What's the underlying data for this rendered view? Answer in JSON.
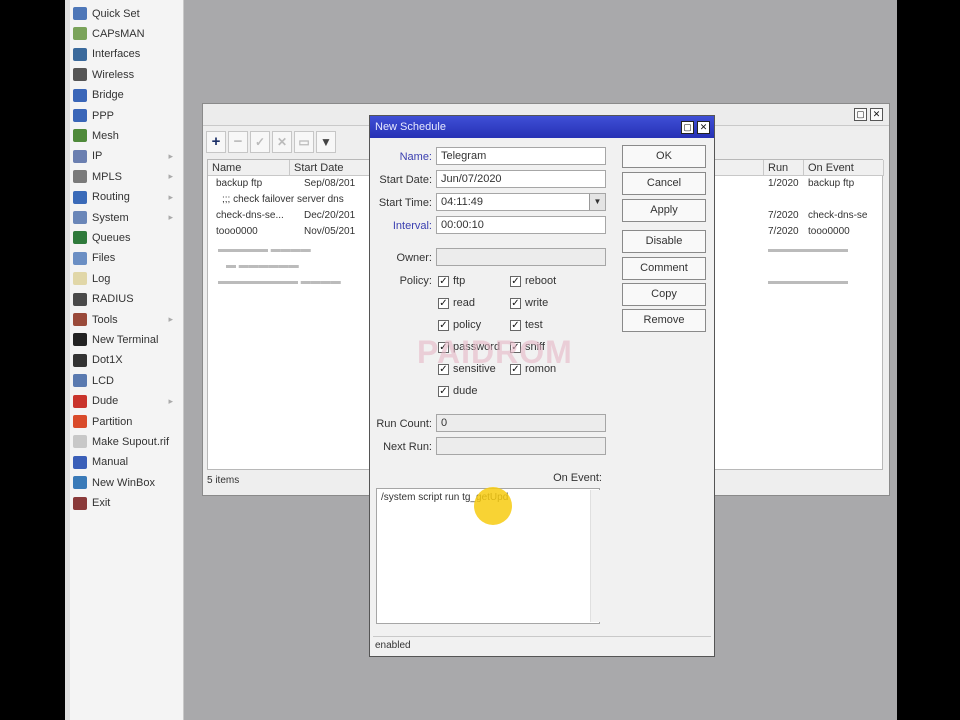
{
  "menu": {
    "items": [
      {
        "label": "Quick Set",
        "icon": "quick-set-icon",
        "color": "#4e77b8"
      },
      {
        "label": "CAPsMAN",
        "icon": "capsman-icon",
        "color": "#7aa35a"
      },
      {
        "label": "Interfaces",
        "icon": "interfaces-icon",
        "color": "#3b6a9c"
      },
      {
        "label": "Wireless",
        "icon": "wireless-icon",
        "color": "#555555"
      },
      {
        "label": "Bridge",
        "icon": "bridge-icon",
        "color": "#3a66b8"
      },
      {
        "label": "PPP",
        "icon": "ppp-icon",
        "color": "#3a66b8"
      },
      {
        "label": "Mesh",
        "icon": "mesh-icon",
        "color": "#4f8a3a"
      },
      {
        "label": "IP",
        "icon": "ip-icon",
        "color": "#6b7fb0"
      },
      {
        "label": "MPLS",
        "icon": "mpls-icon",
        "color": "#7a7a7a"
      },
      {
        "label": "Routing",
        "icon": "routing-icon",
        "color": "#3a6ab8"
      },
      {
        "label": "System",
        "icon": "system-icon",
        "color": "#6a86b8"
      },
      {
        "label": "Queues",
        "icon": "queues-icon",
        "color": "#2f7a3b"
      },
      {
        "label": "Files",
        "icon": "files-icon",
        "color": "#6b8fc4"
      },
      {
        "label": "Log",
        "icon": "log-icon",
        "color": "#e1d7a8"
      },
      {
        "label": "RADIUS",
        "icon": "radius-icon",
        "color": "#4a4a4a"
      },
      {
        "label": "Tools",
        "icon": "tools-icon",
        "color": "#9a4a3a"
      },
      {
        "label": "New Terminal",
        "icon": "terminal-icon",
        "color": "#222222"
      },
      {
        "label": "Dot1X",
        "icon": "dot1x-icon",
        "color": "#333333"
      },
      {
        "label": "LCD",
        "icon": "lcd-icon",
        "color": "#5a7ab0"
      },
      {
        "label": "Dude",
        "icon": "dude-icon",
        "color": "#c9342c"
      },
      {
        "label": "Partition",
        "icon": "partition-icon",
        "color": "#d94b2b"
      },
      {
        "label": "Make Supout.rif",
        "icon": "supout-icon",
        "color": "#c8c8c8"
      },
      {
        "label": "Manual",
        "icon": "manual-icon",
        "color": "#3a5fb8"
      },
      {
        "label": "New WinBox",
        "icon": "winbox-icon",
        "color": "#3a7ab8"
      },
      {
        "label": "Exit",
        "icon": "exit-icon",
        "color": "#8a3a3a"
      }
    ]
  },
  "scheduler": {
    "columns": [
      "Name",
      "Start Date",
      "Run",
      "On Event"
    ],
    "rows": [
      {
        "name": "backup ftp",
        "start_date": "Sep/08/201",
        "run": "1/2020",
        "on_event": "backup ftp"
      },
      {
        "name": ";;; check failover server dns",
        "start_date": "",
        "run": "",
        "on_event": ""
      },
      {
        "name": "check-dns-se...",
        "start_date": "Dec/20/201",
        "run": "7/2020",
        "on_event": "check-dns-se"
      },
      {
        "name": "tooo0000",
        "start_date": "Nov/05/201",
        "run": "7/2020",
        "on_event": "tooo0000"
      }
    ],
    "status": "5 items"
  },
  "dialog": {
    "title": "New Schedule",
    "fields": {
      "name_label": "Name:",
      "name_value": "Telegram",
      "start_date_label": "Start Date:",
      "start_date_value": "Jun/07/2020",
      "start_time_label": "Start Time:",
      "start_time_value": "04:11:49",
      "interval_label": "Interval:",
      "interval_value": "00:00:10",
      "owner_label": "Owner:",
      "owner_value": "",
      "policy_label": "Policy:",
      "run_count_label": "Run Count:",
      "run_count_value": "0",
      "next_run_label": "Next Run:",
      "next_run_value": "",
      "on_event_label": "On Event:",
      "on_event_value": "/system script run tg_getUpd"
    },
    "policies": [
      {
        "label": "ftp",
        "checked": true
      },
      {
        "label": "reboot",
        "checked": true
      },
      {
        "label": "read",
        "checked": true
      },
      {
        "label": "write",
        "checked": true
      },
      {
        "label": "policy",
        "checked": true
      },
      {
        "label": "test",
        "checked": true
      },
      {
        "label": "password",
        "checked": true
      },
      {
        "label": "sniff",
        "checked": true
      },
      {
        "label": "sensitive",
        "checked": true
      },
      {
        "label": "romon",
        "checked": true
      },
      {
        "label": "dude",
        "checked": true
      }
    ],
    "buttons": [
      "OK",
      "Cancel",
      "Apply",
      "Disable",
      "Comment",
      "Copy",
      "Remove"
    ],
    "status": "enabled"
  }
}
